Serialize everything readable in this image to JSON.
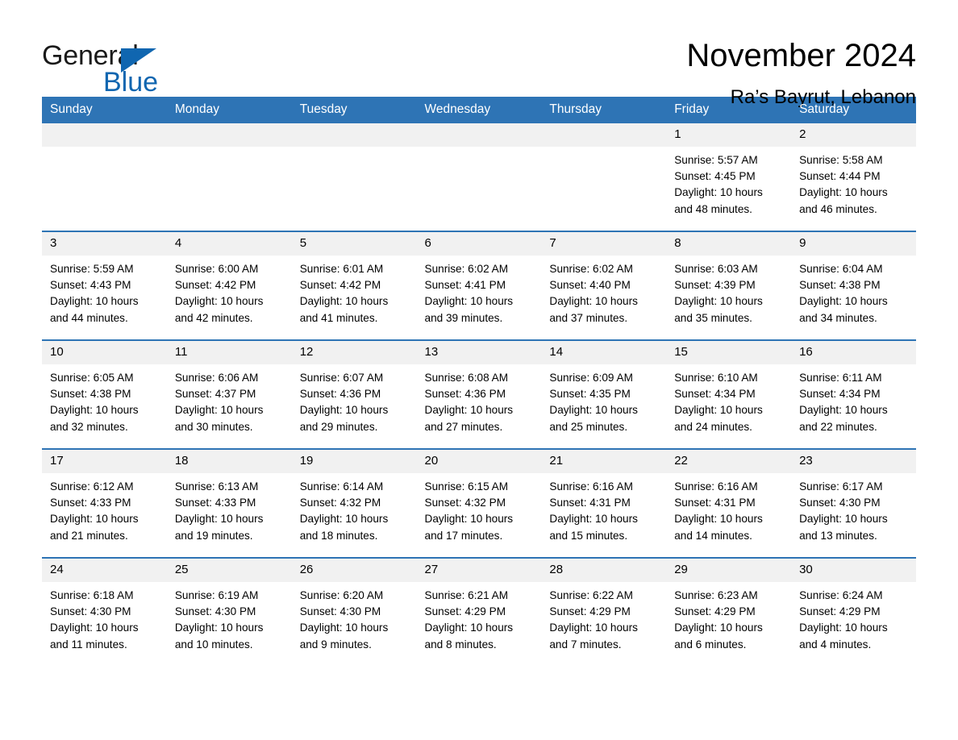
{
  "brand": {
    "name_part1": "General",
    "name_part2": "Blue",
    "triangle_icon": "blue-triangle-icon",
    "accent_color": "#1066b0"
  },
  "header": {
    "title": "November 2024",
    "subtitle": "Ra’s Bayrut, Lebanon"
  },
  "theme": {
    "header_blue": "#2e74b5",
    "daynum_gray": "#f1f1f1",
    "cell_white": "#ffffff",
    "text_black": "#000000"
  },
  "labels": {
    "sunrise_prefix": "Sunrise:",
    "sunset_prefix": "Sunset:",
    "daylight_prefix": "Daylight:"
  },
  "weekdays": [
    "Sunday",
    "Monday",
    "Tuesday",
    "Wednesday",
    "Thursday",
    "Friday",
    "Saturday"
  ],
  "weeks": [
    [
      {
        "day": "",
        "empty": true,
        "line1": "",
        "line2": "",
        "line3": "",
        "line4": ""
      },
      {
        "day": "",
        "empty": true,
        "line1": "",
        "line2": "",
        "line3": "",
        "line4": ""
      },
      {
        "day": "",
        "empty": true,
        "line1": "",
        "line2": "",
        "line3": "",
        "line4": ""
      },
      {
        "day": "",
        "empty": true,
        "line1": "",
        "line2": "",
        "line3": "",
        "line4": ""
      },
      {
        "day": "",
        "empty": true,
        "line1": "",
        "line2": "",
        "line3": "",
        "line4": ""
      },
      {
        "day": "1",
        "empty": false,
        "line1": "Sunrise: 5:57 AM",
        "line2": "Sunset: 4:45 PM",
        "line3": "Daylight: 10 hours",
        "line4": "and 48 minutes."
      },
      {
        "day": "2",
        "empty": false,
        "line1": "Sunrise: 5:58 AM",
        "line2": "Sunset: 4:44 PM",
        "line3": "Daylight: 10 hours",
        "line4": "and 46 minutes."
      }
    ],
    [
      {
        "day": "3",
        "empty": false,
        "line1": "Sunrise: 5:59 AM",
        "line2": "Sunset: 4:43 PM",
        "line3": "Daylight: 10 hours",
        "line4": "and 44 minutes."
      },
      {
        "day": "4",
        "empty": false,
        "line1": "Sunrise: 6:00 AM",
        "line2": "Sunset: 4:42 PM",
        "line3": "Daylight: 10 hours",
        "line4": "and 42 minutes."
      },
      {
        "day": "5",
        "empty": false,
        "line1": "Sunrise: 6:01 AM",
        "line2": "Sunset: 4:42 PM",
        "line3": "Daylight: 10 hours",
        "line4": "and 41 minutes."
      },
      {
        "day": "6",
        "empty": false,
        "line1": "Sunrise: 6:02 AM",
        "line2": "Sunset: 4:41 PM",
        "line3": "Daylight: 10 hours",
        "line4": "and 39 minutes."
      },
      {
        "day": "7",
        "empty": false,
        "line1": "Sunrise: 6:02 AM",
        "line2": "Sunset: 4:40 PM",
        "line3": "Daylight: 10 hours",
        "line4": "and 37 minutes."
      },
      {
        "day": "8",
        "empty": false,
        "line1": "Sunrise: 6:03 AM",
        "line2": "Sunset: 4:39 PM",
        "line3": "Daylight: 10 hours",
        "line4": "and 35 minutes."
      },
      {
        "day": "9",
        "empty": false,
        "line1": "Sunrise: 6:04 AM",
        "line2": "Sunset: 4:38 PM",
        "line3": "Daylight: 10 hours",
        "line4": "and 34 minutes."
      }
    ],
    [
      {
        "day": "10",
        "empty": false,
        "line1": "Sunrise: 6:05 AM",
        "line2": "Sunset: 4:38 PM",
        "line3": "Daylight: 10 hours",
        "line4": "and 32 minutes."
      },
      {
        "day": "11",
        "empty": false,
        "line1": "Sunrise: 6:06 AM",
        "line2": "Sunset: 4:37 PM",
        "line3": "Daylight: 10 hours",
        "line4": "and 30 minutes."
      },
      {
        "day": "12",
        "empty": false,
        "line1": "Sunrise: 6:07 AM",
        "line2": "Sunset: 4:36 PM",
        "line3": "Daylight: 10 hours",
        "line4": "and 29 minutes."
      },
      {
        "day": "13",
        "empty": false,
        "line1": "Sunrise: 6:08 AM",
        "line2": "Sunset: 4:36 PM",
        "line3": "Daylight: 10 hours",
        "line4": "and 27 minutes."
      },
      {
        "day": "14",
        "empty": false,
        "line1": "Sunrise: 6:09 AM",
        "line2": "Sunset: 4:35 PM",
        "line3": "Daylight: 10 hours",
        "line4": "and 25 minutes."
      },
      {
        "day": "15",
        "empty": false,
        "line1": "Sunrise: 6:10 AM",
        "line2": "Sunset: 4:34 PM",
        "line3": "Daylight: 10 hours",
        "line4": "and 24 minutes."
      },
      {
        "day": "16",
        "empty": false,
        "line1": "Sunrise: 6:11 AM",
        "line2": "Sunset: 4:34 PM",
        "line3": "Daylight: 10 hours",
        "line4": "and 22 minutes."
      }
    ],
    [
      {
        "day": "17",
        "empty": false,
        "line1": "Sunrise: 6:12 AM",
        "line2": "Sunset: 4:33 PM",
        "line3": "Daylight: 10 hours",
        "line4": "and 21 minutes."
      },
      {
        "day": "18",
        "empty": false,
        "line1": "Sunrise: 6:13 AM",
        "line2": "Sunset: 4:33 PM",
        "line3": "Daylight: 10 hours",
        "line4": "and 19 minutes."
      },
      {
        "day": "19",
        "empty": false,
        "line1": "Sunrise: 6:14 AM",
        "line2": "Sunset: 4:32 PM",
        "line3": "Daylight: 10 hours",
        "line4": "and 18 minutes."
      },
      {
        "day": "20",
        "empty": false,
        "line1": "Sunrise: 6:15 AM",
        "line2": "Sunset: 4:32 PM",
        "line3": "Daylight: 10 hours",
        "line4": "and 17 minutes."
      },
      {
        "day": "21",
        "empty": false,
        "line1": "Sunrise: 6:16 AM",
        "line2": "Sunset: 4:31 PM",
        "line3": "Daylight: 10 hours",
        "line4": "and 15 minutes."
      },
      {
        "day": "22",
        "empty": false,
        "line1": "Sunrise: 6:16 AM",
        "line2": "Sunset: 4:31 PM",
        "line3": "Daylight: 10 hours",
        "line4": "and 14 minutes."
      },
      {
        "day": "23",
        "empty": false,
        "line1": "Sunrise: 6:17 AM",
        "line2": "Sunset: 4:30 PM",
        "line3": "Daylight: 10 hours",
        "line4": "and 13 minutes."
      }
    ],
    [
      {
        "day": "24",
        "empty": false,
        "line1": "Sunrise: 6:18 AM",
        "line2": "Sunset: 4:30 PM",
        "line3": "Daylight: 10 hours",
        "line4": "and 11 minutes."
      },
      {
        "day": "25",
        "empty": false,
        "line1": "Sunrise: 6:19 AM",
        "line2": "Sunset: 4:30 PM",
        "line3": "Daylight: 10 hours",
        "line4": "and 10 minutes."
      },
      {
        "day": "26",
        "empty": false,
        "line1": "Sunrise: 6:20 AM",
        "line2": "Sunset: 4:30 PM",
        "line3": "Daylight: 10 hours",
        "line4": "and 9 minutes."
      },
      {
        "day": "27",
        "empty": false,
        "line1": "Sunrise: 6:21 AM",
        "line2": "Sunset: 4:29 PM",
        "line3": "Daylight: 10 hours",
        "line4": "and 8 minutes."
      },
      {
        "day": "28",
        "empty": false,
        "line1": "Sunrise: 6:22 AM",
        "line2": "Sunset: 4:29 PM",
        "line3": "Daylight: 10 hours",
        "line4": "and 7 minutes."
      },
      {
        "day": "29",
        "empty": false,
        "line1": "Sunrise: 6:23 AM",
        "line2": "Sunset: 4:29 PM",
        "line3": "Daylight: 10 hours",
        "line4": "and 6 minutes."
      },
      {
        "day": "30",
        "empty": false,
        "line1": "Sunrise: 6:24 AM",
        "line2": "Sunset: 4:29 PM",
        "line3": "Daylight: 10 hours",
        "line4": "and 4 minutes."
      }
    ]
  ]
}
